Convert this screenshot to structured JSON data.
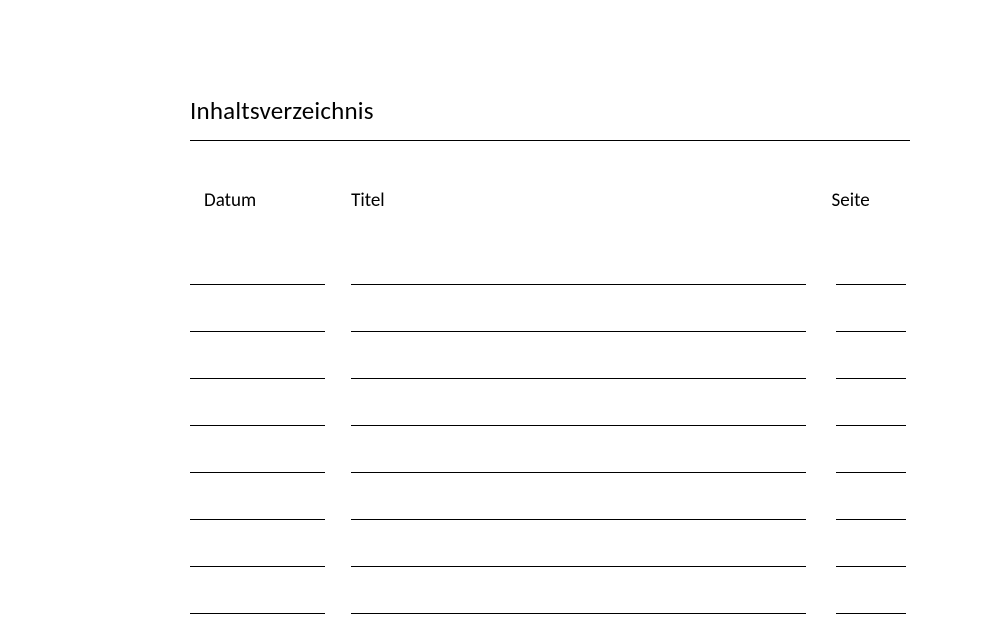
{
  "title": "Inhaltsverzeichnis",
  "columns": {
    "datum": "Datum",
    "titel": "Titel",
    "seite": "Seite"
  },
  "rows": [
    {
      "datum": "",
      "titel": "",
      "seite": ""
    },
    {
      "datum": "",
      "titel": "",
      "seite": ""
    },
    {
      "datum": "",
      "titel": "",
      "seite": ""
    },
    {
      "datum": "",
      "titel": "",
      "seite": ""
    },
    {
      "datum": "",
      "titel": "",
      "seite": ""
    },
    {
      "datum": "",
      "titel": "",
      "seite": ""
    },
    {
      "datum": "",
      "titel": "",
      "seite": ""
    },
    {
      "datum": "",
      "titel": "",
      "seite": ""
    }
  ]
}
